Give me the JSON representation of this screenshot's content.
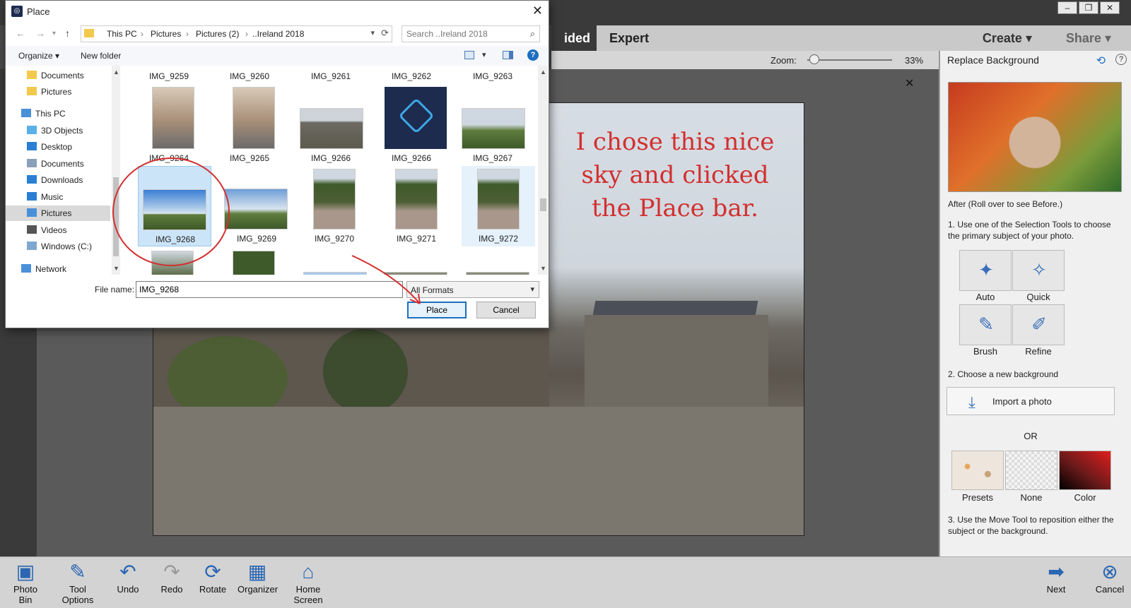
{
  "app": {
    "modes": {
      "guided": "ided",
      "expert": "Expert"
    },
    "create": "Create",
    "share": "Share",
    "zoom_label": "Zoom:",
    "zoom_value": "33%",
    "zoom_level": 0.08,
    "close_glyph": "✕",
    "window_controls": [
      "–",
      "❐",
      "✕"
    ]
  },
  "annotation": {
    "lines": [
      "I chose this nice",
      "sky and clicked",
      "the Place bar."
    ],
    "color": "#d32f2f"
  },
  "panel": {
    "title": "Replace Background",
    "help": "?",
    "after_caption": "After (Roll over to see Before.)",
    "step1": "1. Use one of the Selection Tools to choose the primary subject of your photo.",
    "tools": [
      {
        "label": "Auto",
        "icon": "magic-wand-icon"
      },
      {
        "label": "Quick",
        "icon": "quick-selection-icon"
      },
      {
        "label": "Brush",
        "icon": "brush-icon"
      },
      {
        "label": "Refine",
        "icon": "refine-icon"
      }
    ],
    "step2": "2. Choose a new background",
    "import_label": "Import a photo",
    "or": "OR",
    "backgrounds": [
      {
        "label": "Presets"
      },
      {
        "label": "None"
      },
      {
        "label": "Color"
      }
    ],
    "step3": "3. Use the Move Tool to reposition either the subject or the background."
  },
  "bottom_bar": {
    "items": [
      "Photo Bin",
      "Tool Options",
      "Undo",
      "Redo",
      "Rotate",
      "Organizer",
      "Home Screen"
    ],
    "next": "Next",
    "cancel": "Cancel"
  },
  "dialog": {
    "title": "Place",
    "close": "✕",
    "breadcrumbs": [
      "This PC",
      "Pictures",
      "Pictures (2)",
      "..Ireland 2018"
    ],
    "search_placeholder": "Search ..Ireland 2018",
    "organize": "Organize ▾",
    "new_folder": "New folder",
    "help": "?",
    "nav_items": [
      {
        "label": "Documents",
        "icon": "folder-icon"
      },
      {
        "label": "Pictures",
        "icon": "folder-icon"
      },
      {
        "label": "This PC",
        "icon": "computer-icon"
      },
      {
        "label": "3D Objects",
        "icon": "cube-icon"
      },
      {
        "label": "Desktop",
        "icon": "desktop-icon"
      },
      {
        "label": "Documents",
        "icon": "documents-icon"
      },
      {
        "label": "Downloads",
        "icon": "download-icon"
      },
      {
        "label": "Music",
        "icon": "music-icon"
      },
      {
        "label": "Pictures",
        "icon": "pictures-icon"
      },
      {
        "label": "Videos",
        "icon": "videos-icon"
      },
      {
        "label": "Windows (C:)",
        "icon": "drive-icon"
      },
      {
        "label": "Network",
        "icon": "network-icon"
      }
    ],
    "files_top_row": [
      "IMG_9259",
      "IMG_9260",
      "IMG_9261",
      "IMG_9262",
      "IMG_9263"
    ],
    "files_row2": [
      "IMG_9264",
      "IMG_9265",
      "IMG_9266",
      "IMG_9266",
      "IMG_9267"
    ],
    "files_row3": [
      "IMG_9268",
      "IMG_9269",
      "IMG_9270",
      "IMG_9271",
      "IMG_9272"
    ],
    "selected_file": "IMG_9268",
    "filename_label": "File name:",
    "filename_value": "IMG_9268",
    "filetype": "All Formats",
    "place_label": "Place",
    "cancel_label": "Cancel"
  }
}
